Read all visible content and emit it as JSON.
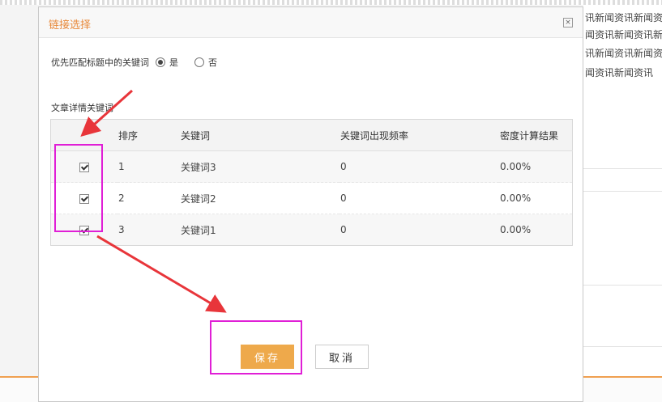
{
  "background": {
    "lines": [
      "讯新闻资讯新闻资",
      "闻资讯新闻资讯新",
      "讯新闻资讯新闻资",
      "闻资讯新闻资讯"
    ]
  },
  "dialog": {
    "title": "链接选择",
    "close_symbol": "×",
    "pref_label": "优先匹配标题中的关键词",
    "option_yes": "是",
    "option_no": "否",
    "selected_option": "yes",
    "section_label": "文章详情关键词",
    "table": {
      "headers": [
        "排序",
        "关键词",
        "关键词出现频率",
        "密度计算结果"
      ],
      "rows": [
        {
          "checked": true,
          "order": "1",
          "keyword": "关键词3",
          "frequency": "0",
          "density": "0.00%"
        },
        {
          "checked": true,
          "order": "2",
          "keyword": "关键词2",
          "frequency": "0",
          "density": "0.00%"
        },
        {
          "checked": true,
          "order": "3",
          "keyword": "关键词1",
          "frequency": "0",
          "density": "0.00%"
        }
      ]
    },
    "save_label": "保存",
    "cancel_label": "取消"
  },
  "colors": {
    "title": "#e8893a",
    "save_button": "#eea94b",
    "highlight": "#e01fd6",
    "arrow": "#e8353a"
  }
}
